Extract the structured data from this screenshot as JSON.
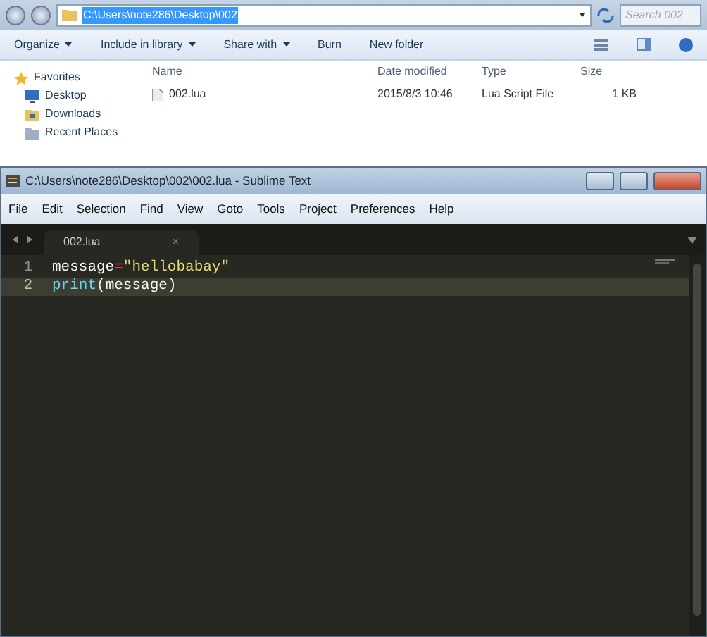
{
  "explorer": {
    "address": "C:\\Users\\note286\\Desktop\\002",
    "search": {
      "placeholder": "Search 002"
    },
    "toolbar": [
      {
        "label": "Organize",
        "dropdown": true
      },
      {
        "label": "Include in library",
        "dropdown": true
      },
      {
        "label": "Share with",
        "dropdown": true
      },
      {
        "label": "Burn",
        "dropdown": false
      },
      {
        "label": "New folder",
        "dropdown": false
      }
    ],
    "sidebar": [
      {
        "label": "Favorites",
        "kind": "star"
      },
      {
        "label": "Desktop",
        "kind": "desktop"
      },
      {
        "label": "Downloads",
        "kind": "downloads"
      },
      {
        "label": "Recent Places",
        "kind": "recent"
      }
    ],
    "columns": [
      "Name",
      "Date modified",
      "Type",
      "Size"
    ],
    "files": [
      {
        "name": "002.lua",
        "modified": "2015/8/3 10:46",
        "type": "Lua Script File",
        "size": "1 KB"
      }
    ]
  },
  "editor": {
    "title": "C:\\Users\\note286\\Desktop\\002\\002.lua - Sublime Text",
    "menu": [
      "File",
      "Edit",
      "Selection",
      "Find",
      "View",
      "Goto",
      "Tools",
      "Project",
      "Preferences",
      "Help"
    ],
    "tabs": [
      {
        "label": "002.lua",
        "selected": true,
        "close": "×"
      }
    ],
    "lines": [
      {
        "number": "1",
        "current": false,
        "tokens": [
          {
            "kind": "name",
            "text": "message"
          },
          {
            "kind": "operator",
            "text": "="
          },
          {
            "kind": "string",
            "text": "\"hellobabay\""
          }
        ]
      },
      {
        "number": "2",
        "current": true,
        "tokens": [
          {
            "kind": "function",
            "text": "print"
          },
          {
            "kind": "paren",
            "text": "("
          },
          {
            "kind": "name",
            "text": "message"
          },
          {
            "kind": "paren",
            "text": ")"
          }
        ]
      }
    ]
  }
}
